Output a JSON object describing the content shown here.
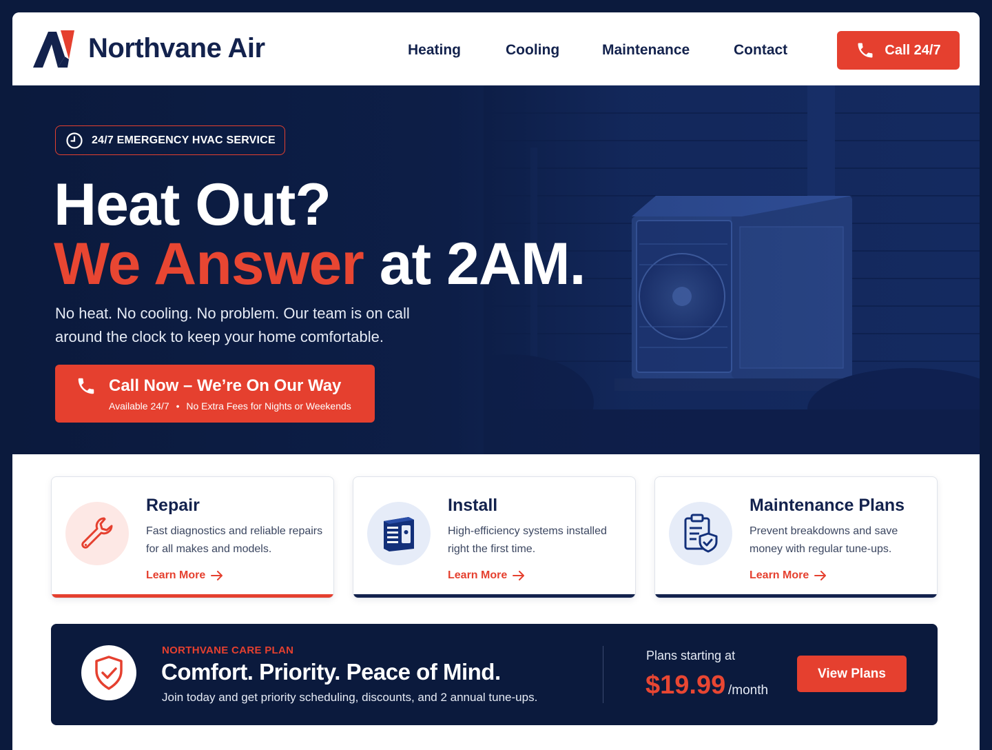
{
  "brand": {
    "name": "Northvane Air"
  },
  "nav": {
    "items": [
      "Heating",
      "Cooling",
      "Maintenance",
      "Contact"
    ]
  },
  "header": {
    "call_label": "Call 24/7"
  },
  "hero": {
    "badge": "24/7 EMERGENCY HVAC SERVICE",
    "headline_line1": "Heat Out?",
    "headline_accent": "We Answer",
    "headline_rest": "at 2AM.",
    "subtext": "No heat. No cooling. No problem. Our team is on call around the clock to keep your home comfortable.",
    "cta_title": "Call Now – We’re On Our Way",
    "cta_sub_1": "Available 24/7",
    "cta_sub_sep": "•",
    "cta_sub_2": "No Extra Fees for Nights or Weekends"
  },
  "services": [
    {
      "title": "Repair",
      "description": "Fast diagnostics and reliable repairs for all makes and models.",
      "link": "Learn More",
      "icon": "wrench-icon"
    },
    {
      "title": "Install",
      "description": "High-efficiency systems installed right the first time.",
      "link": "Learn More",
      "icon": "hvac-unit-icon"
    },
    {
      "title": "Maintenance Plans",
      "description": "Prevent breakdowns and save money with regular tune-ups.",
      "link": "Learn More",
      "icon": "clipboard-shield-icon"
    }
  ],
  "plan": {
    "eyebrow": "NORTHVANE CARE PLAN",
    "title": "Comfort. Priority. Peace of Mind.",
    "description": "Join today and get priority scheduling, discounts, and 2 annual tune-ups.",
    "starting_label": "Plans starting at",
    "price": "$19.99",
    "per": "/month",
    "button": "View Plans"
  },
  "colors": {
    "navy": "#0b1a3d",
    "accent": "#e5402f",
    "white": "#ffffff"
  }
}
